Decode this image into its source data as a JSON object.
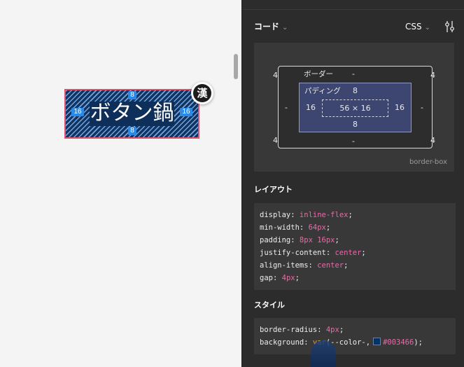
{
  "canvas": {
    "button_text": "ボタン鍋",
    "padding_top": "8",
    "padding_bottom": "8",
    "padding_left": "16",
    "padding_right": "16",
    "kanji_icon_glyph": "漢",
    "accent_outline": "#e0506c",
    "button_bg": "#12355f"
  },
  "panel": {
    "title": "コード",
    "language": "CSS",
    "box_model": {
      "margin_top_left": "4",
      "margin_top_right": "4",
      "margin_bottom_left": "4",
      "margin_bottom_right": "4",
      "border_label": "ボーダー",
      "border_top": "-",
      "border_left": "-",
      "border_right": "-",
      "border_bottom": "-",
      "padding_label": "パディング",
      "padding_top": "8",
      "padding_left": "16",
      "padding_right": "16",
      "padding_bottom": "8",
      "content_size": "56 × 16",
      "box_sizing": "border-box"
    },
    "layout_title": "レイアウト",
    "layout_lines": [
      {
        "prop": "display",
        "value": "inline-flex"
      },
      {
        "prop": "min-width",
        "value": "64px"
      },
      {
        "prop": "padding",
        "value": "8px 16px"
      },
      {
        "prop": "justify-content",
        "value": "center"
      },
      {
        "prop": "align-items",
        "value": "center"
      },
      {
        "prop": "gap",
        "value": "4px"
      }
    ],
    "style_title": "スタイル",
    "style_lines": [
      {
        "prop": "border-radius",
        "value": "4px"
      }
    ],
    "background_line": {
      "prop": "background",
      "fn": "var",
      "var_name": "(--color-,",
      "color": "#003466",
      "closing": ");"
    }
  }
}
